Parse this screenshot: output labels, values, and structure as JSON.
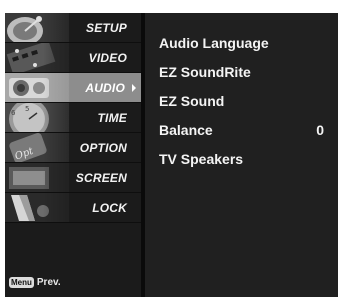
{
  "sidebar": {
    "items": [
      {
        "label": "SETUP",
        "icon": "satellite-dish-icon"
      },
      {
        "label": "VIDEO",
        "icon": "film-reel-icon"
      },
      {
        "label": "AUDIO",
        "icon": "speaker-icon",
        "selected": true
      },
      {
        "label": "TIME",
        "icon": "clock-icon"
      },
      {
        "label": "OPTION",
        "icon": "option-tag-icon"
      },
      {
        "label": "SCREEN",
        "icon": "monitor-icon"
      },
      {
        "label": "LOCK",
        "icon": "lock-icon"
      }
    ],
    "footer": {
      "key_label": "Menu",
      "action_label": "Prev."
    }
  },
  "audio_menu": {
    "options": [
      {
        "label": "Audio Language",
        "value": ""
      },
      {
        "label": "EZ SoundRite",
        "value": ""
      },
      {
        "label": "EZ Sound",
        "value": ""
      },
      {
        "label": "Balance",
        "value": "0"
      },
      {
        "label": "TV Speakers",
        "value": ""
      }
    ]
  },
  "colors": {
    "background": "#161616",
    "selected_item": "#8d8d8d",
    "text": "#f4f4f4"
  }
}
